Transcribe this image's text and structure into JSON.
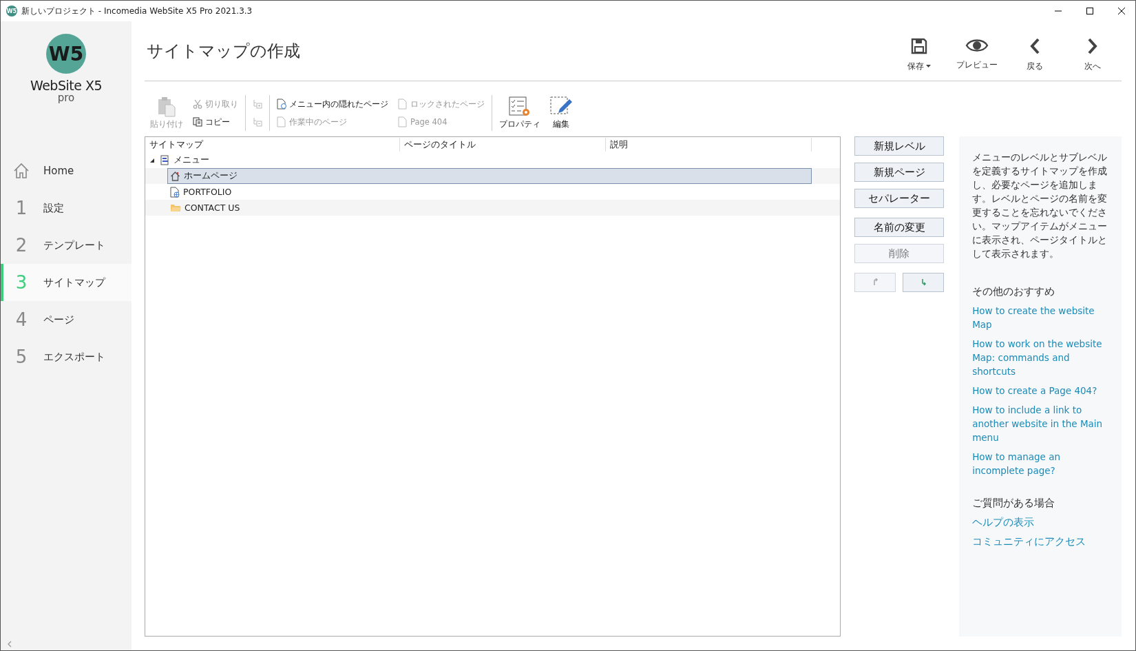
{
  "window": {
    "icon_text": "W5",
    "title": "新しいプロジェクト - Incomedia WebSite X5 Pro 2021.3.3"
  },
  "logo": {
    "mark": "W5",
    "name": "WebSite X5",
    "edition": "pro"
  },
  "sidebar": {
    "items": [
      {
        "label": "Home",
        "selected": false,
        "kind": "home"
      },
      {
        "number": "1",
        "label": "設定",
        "selected": false,
        "kind": "step"
      },
      {
        "number": "2",
        "label": "テンプレート",
        "selected": false,
        "kind": "step"
      },
      {
        "number": "3",
        "label": "サイトマップ",
        "selected": true,
        "kind": "step"
      },
      {
        "number": "4",
        "label": "ページ",
        "selected": false,
        "kind": "step"
      },
      {
        "number": "5",
        "label": "エクスポート",
        "selected": false,
        "kind": "step"
      }
    ]
  },
  "page_title": "サイトマップの作成",
  "actions": [
    {
      "label": "保存",
      "dropdown": true
    },
    {
      "label": "プレビュー",
      "dropdown": false
    },
    {
      "label": "戻る",
      "dropdown": false
    },
    {
      "label": "次へ",
      "dropdown": false
    }
  ],
  "toolbar": [
    {
      "items": [
        {
          "kind": "large",
          "label": "貼り付け",
          "disabled": true
        },
        {
          "kind": "small",
          "label": "切り取り",
          "disabled": true
        },
        {
          "kind": "small",
          "label": "コピー",
          "disabled": false
        }
      ]
    },
    {
      "items": [
        {
          "kind": "icon",
          "disabled": true
        },
        {
          "kind": "icon",
          "disabled": true
        }
      ]
    },
    {
      "items": [
        {
          "kind": "small",
          "label": "メニュー内の隠れたページ",
          "disabled": false
        },
        {
          "kind": "small",
          "label": "作業中のページ",
          "disabled": true
        },
        {
          "kind": "small",
          "label": "ロックされたページ",
          "disabled": true
        },
        {
          "kind": "small",
          "label": "Page 404",
          "disabled": true
        }
      ]
    },
    {
      "items": [
        {
          "kind": "large",
          "label": "プロパティ",
          "disabled": false
        },
        {
          "kind": "large",
          "label": "編集",
          "disabled": false
        }
      ]
    }
  ],
  "table": {
    "columns": [
      "サイトマップ",
      "ページのタイトル",
      "説明"
    ],
    "tree": [
      {
        "label": "メニュー",
        "kind": "root",
        "expanded": true,
        "selected": false,
        "children": [
          {
            "label": "ホームページ",
            "kind": "home",
            "selected": true
          },
          {
            "label": "PORTFOLIO",
            "kind": "page",
            "selected": false
          },
          {
            "label": "CONTACT US",
            "kind": "folder",
            "selected": false
          }
        ]
      }
    ]
  },
  "buttons": [
    {
      "label": "新規レベル",
      "disabled": false
    },
    {
      "label": "新規ページ",
      "disabled": false
    },
    {
      "label": "セパレーター",
      "disabled": false
    },
    {
      "label": "名前の変更",
      "disabled": false
    },
    {
      "label": "削除",
      "disabled": true
    }
  ],
  "move_buttons": [
    {
      "kind": "up",
      "disabled": true
    },
    {
      "kind": "down",
      "disabled": false
    }
  ],
  "help": {
    "text": "メニューのレベルとサブレベルを定義するサイトマップを作成し、必要なページを追加します。レベルとページの名前を変更することを忘れないでください。マップアイテムがメニューに表示され、ページタイトルとして表示されます。",
    "sections": [
      {
        "heading": "その他のおすすめ",
        "links": [
          "How to create the website Map",
          "How to work on the website Map: commands and shortcuts",
          "How to create a Page 404?",
          "How to include a link to another website in the Main menu",
          "How to manage an incomplete page?"
        ]
      },
      {
        "heading": "ご質問がある場合",
        "links": [
          "ヘルプの表示",
          "コミュニティにアクセス"
        ]
      }
    ]
  }
}
